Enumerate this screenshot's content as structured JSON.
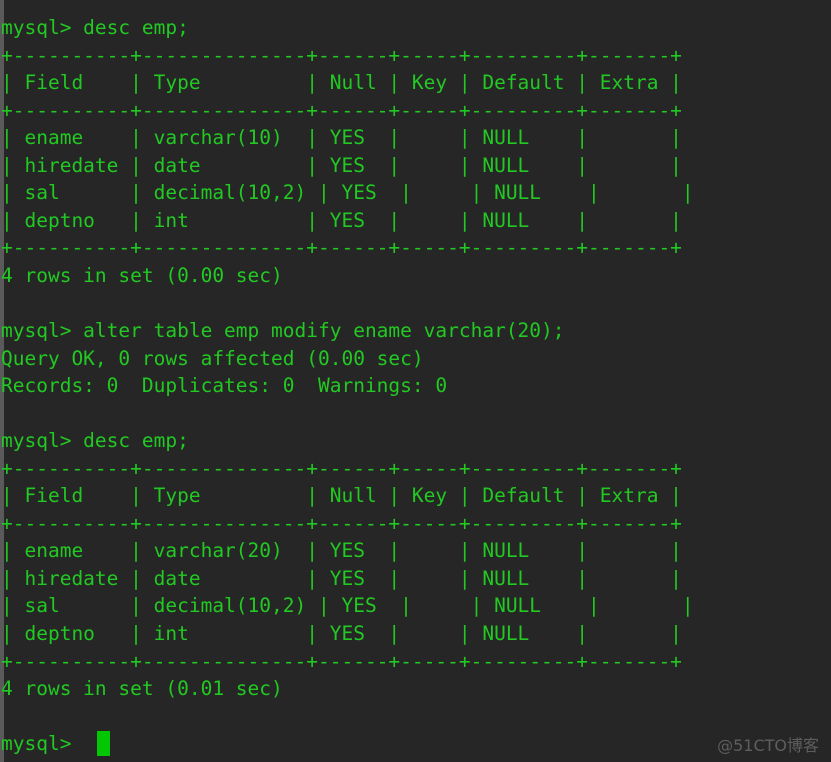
{
  "terminal": {
    "background_color": "#262626",
    "text_color": "#22c922",
    "cursor_color": "#03c703",
    "scrollbar_color": "#5a5a5a",
    "prompt": "mysql> ",
    "lines": [
      "mysql> desc emp;",
      "+----------+--------------+------+-----+---------+-------+",
      "| Field    | Type         | Null | Key | Default | Extra |",
      "+----------+--------------+------+-----+---------+-------+",
      "| ename    | varchar(10)  | YES  |     | NULL    |       |",
      "| hiredate | date         | YES  |     | NULL    |       |",
      "| sal      | decimal(10,2) | YES  |     | NULL    |       |",
      "| deptno   | int          | YES  |     | NULL    |       |",
      "+----------+--------------+------+-----+---------+-------+",
      "4 rows in set (0.00 sec)",
      "",
      "mysql> alter table emp modify ename varchar(20);",
      "Query OK, 0 rows affected (0.00 sec)",
      "Records: 0  Duplicates: 0  Warnings: 0",
      "",
      "mysql> desc emp;",
      "+----------+--------------+------+-----+---------+-------+",
      "| Field    | Type         | Null | Key | Default | Extra |",
      "+----------+--------------+------+-----+---------+-------+",
      "| ename    | varchar(20)  | YES  |     | NULL    |       |",
      "| hiredate | date         | YES  |     | NULL    |       |",
      "| sal      | decimal(10,2) | YES  |     | NULL    |       |",
      "| deptno   | int          | YES  |     | NULL    |       |",
      "+----------+--------------+------+-----+---------+-------+",
      "4 rows in set (0.01 sec)",
      ""
    ],
    "sessions": [
      {
        "command": "desc emp;",
        "result_table": {
          "headers": [
            "Field",
            "Type",
            "Null",
            "Key",
            "Default",
            "Extra"
          ],
          "rows": [
            [
              "ename",
              "varchar(10)",
              "YES",
              "",
              "NULL",
              ""
            ],
            [
              "hiredate",
              "date",
              "YES",
              "",
              "NULL",
              ""
            ],
            [
              "sal",
              "decimal(10,2)",
              "YES",
              "",
              "NULL",
              ""
            ],
            [
              "deptno",
              "int",
              "YES",
              "",
              "NULL",
              ""
            ]
          ]
        },
        "status": "4 rows in set (0.00 sec)"
      },
      {
        "command": "alter table emp modify ename varchar(20);",
        "status": "Query OK, 0 rows affected (0.00 sec)",
        "detail": "Records: 0  Duplicates: 0  Warnings: 0"
      },
      {
        "command": "desc emp;",
        "result_table": {
          "headers": [
            "Field",
            "Type",
            "Null",
            "Key",
            "Default",
            "Extra"
          ],
          "rows": [
            [
              "ename",
              "varchar(20)",
              "YES",
              "",
              "NULL",
              ""
            ],
            [
              "hiredate",
              "date",
              "YES",
              "",
              "NULL",
              ""
            ],
            [
              "sal",
              "decimal(10,2)",
              "YES",
              "",
              "NULL",
              ""
            ],
            [
              "deptno",
              "int",
              "YES",
              "",
              "NULL",
              ""
            ]
          ]
        },
        "status": "4 rows in set (0.01 sec)"
      }
    ]
  },
  "watermark": {
    "text": "@51CTO博客"
  }
}
